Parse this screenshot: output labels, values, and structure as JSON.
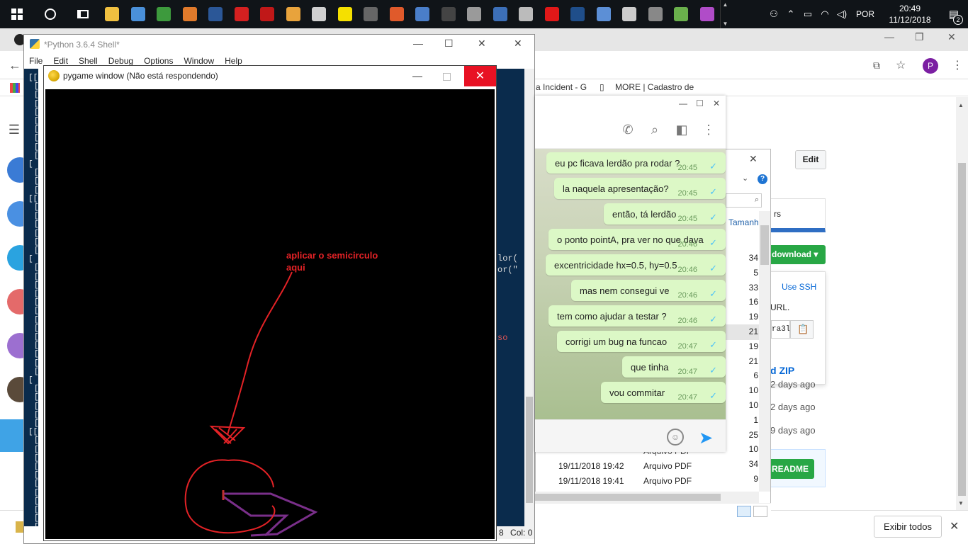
{
  "taskbar": {
    "lang": "POR",
    "time": "20:49",
    "date": "11/12/2018",
    "notification_count": "2",
    "apps": [
      {
        "name": "file-manager-icon",
        "color": "#f0c040"
      },
      {
        "name": "window-icon",
        "color": "#4a90d9"
      },
      {
        "name": "gears-icon",
        "color": "#3d9a3d"
      },
      {
        "name": "document-icon",
        "color": "#e07a2b"
      },
      {
        "name": "word-icon",
        "color": "#2b5797"
      },
      {
        "name": "pdf-icon",
        "color": "#d42020"
      },
      {
        "name": "red-app-icon",
        "color": "#c01818"
      },
      {
        "name": "paint-icon",
        "color": "#e8a33c"
      },
      {
        "name": "palette-icon",
        "color": "#d0d0d0"
      },
      {
        "name": "sticky-note-icon",
        "color": "#f5e000"
      },
      {
        "name": "clock-icon",
        "color": "#666666"
      },
      {
        "name": "puzzle-icon",
        "color": "#e05a2b"
      },
      {
        "name": "monitor-icon",
        "color": "#4a7ec9"
      },
      {
        "name": "calculator-icon",
        "color": "#444444"
      },
      {
        "name": "server-icon",
        "color": "#9a9a9a"
      },
      {
        "name": "network-icon",
        "color": "#3c6fb8"
      },
      {
        "name": "microphone-icon",
        "color": "#bbbbbb"
      },
      {
        "name": "record-icon",
        "color": "#e01818"
      },
      {
        "name": "chart-icon",
        "color": "#1f4e8a"
      },
      {
        "name": "feather-icon",
        "color": "#5c8fd6"
      },
      {
        "name": "hardware-icon",
        "color": "#cccccc"
      },
      {
        "name": "eye-icon",
        "color": "#888888"
      },
      {
        "name": "plant-icon",
        "color": "#6ab04c"
      },
      {
        "name": "balloon-icon",
        "color": "#b04cc8"
      }
    ]
  },
  "chrome": {
    "bookmarks": [
      "a Incident - G",
      "MORE | Cadastro de"
    ],
    "profile_initial": "P",
    "edit_label": "Edit",
    "clone_label": "download ▾",
    "ssh_label": "Use SSH",
    "url_label": "URL.",
    "url_fragment": "ra3l",
    "zip_label": "d ZIP",
    "days_ago": [
      "2 days ago",
      "2 days ago",
      "9 days ago"
    ],
    "readme_label": "README",
    "tab_fragment": "rs"
  },
  "download_bar": {
    "show_all": "Exibir todos",
    "close": "✕"
  },
  "idle": {
    "title": "*Python 3.6.4 Shell*",
    "menu": [
      "File",
      "Edit",
      "Shell",
      "Debug",
      "Options",
      "Window",
      "Help"
    ],
    "code_fragments": [
      "lor(",
      "or(\"",
      "so"
    ],
    "status_line": "8",
    "status_col": "Col: 0"
  },
  "pygame": {
    "title": "pygame window (Não está respondendo)",
    "annotation_line1": "aplicar o semicirculo",
    "annotation_line2": "aqui"
  },
  "chat": {
    "messages": [
      {
        "text": "eu pc ficava lerdão pra rodar ?",
        "time": "20:45"
      },
      {
        "text": "la naquela apresentação?",
        "time": "20:45"
      },
      {
        "text": "então, tá lerdão",
        "time": "20:45"
      },
      {
        "text": "o ponto pointA, pra ver no que dava",
        "time": "20:46"
      },
      {
        "text": "excentricidade hx=0.5, hy=0.5",
        "time": "20:46"
      },
      {
        "text": "mas nem consegui ve",
        "time": "20:46"
      },
      {
        "text": "tem como ajudar a testar ?",
        "time": "20:46"
      },
      {
        "text": "corrigi um bug na funcao",
        "time": "20:47"
      },
      {
        "text": "que tinha",
        "time": "20:47"
      },
      {
        "text": "vou commitar",
        "time": "20:47"
      }
    ]
  },
  "explorer": {
    "column_header": "Tamanh",
    "sizes": [
      "34",
      "5",
      "33",
      "16",
      "19",
      "21",
      "19",
      "21",
      "6",
      "10",
      "10",
      "1",
      "25",
      "10",
      "34",
      "9"
    ],
    "rows": [
      {
        "date": "19/11/2018 19:42",
        "type": "Arquivo PDF"
      },
      {
        "date": "19/11/2018 19:41",
        "type": "Arquivo PDF"
      }
    ],
    "partial_row": "Arquivo PDF"
  }
}
